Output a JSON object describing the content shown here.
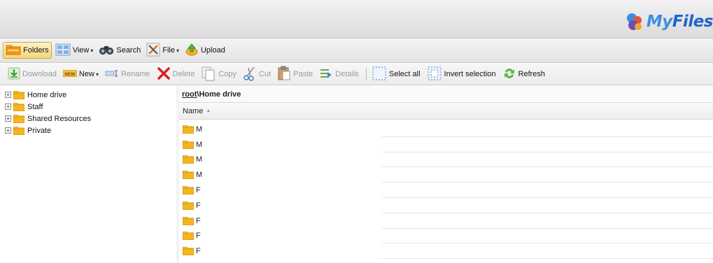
{
  "header": {
    "logo_prefix": "My",
    "logo_suffix": "Files"
  },
  "toolbar1": {
    "folders": "Folders",
    "view": "View",
    "search": "Search",
    "file": "File",
    "upload": "Upload"
  },
  "toolbar2": {
    "download": "Download",
    "new": "New",
    "new_badge": "NEW",
    "rename": "Rename",
    "delete": "Delete",
    "copy": "Copy",
    "cut": "Cut",
    "paste": "Paste",
    "details": "Details",
    "select_all": "Select all",
    "invert_selection": "Invert selection",
    "refresh": "Refresh"
  },
  "tree": {
    "items": [
      {
        "label": "Home drive"
      },
      {
        "label": "Staff"
      },
      {
        "label": "Shared Resources"
      },
      {
        "label": "Private"
      }
    ],
    "expander": "+"
  },
  "main": {
    "path_root": "root",
    "path_separator": "\\",
    "path_current": "Home drive",
    "column_name": "Name",
    "sort_indicator": "▲",
    "files": [
      {
        "name": "M"
      },
      {
        "name": "M"
      },
      {
        "name": "M"
      },
      {
        "name": "M"
      },
      {
        "name": "F"
      },
      {
        "name": "F"
      },
      {
        "name": "F"
      },
      {
        "name": "F"
      },
      {
        "name": "F"
      }
    ]
  },
  "colors": {
    "folder": "#f5b51e",
    "accent": "#2a6fd6",
    "delete_red": "#d62020"
  }
}
